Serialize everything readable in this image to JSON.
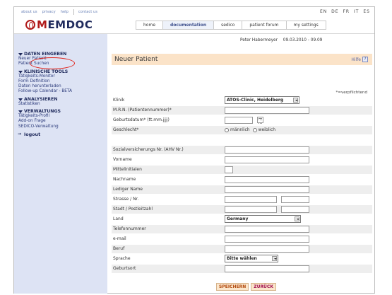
{
  "toplinks": [
    "about us",
    "privacy",
    "help",
    "contact us"
  ],
  "languages": [
    "EN",
    "DE",
    "FR",
    "IT",
    "ES"
  ],
  "logo": {
    "part1": "M",
    "part2": "EMDOC"
  },
  "nav": [
    "home",
    "documentation",
    "sedico",
    "patient forum",
    "my settings"
  ],
  "user": {
    "name": "Peter Habermeyer",
    "date": "09.03.2010 - 09.09"
  },
  "sidebar": {
    "sections": [
      {
        "title": "DATEN EINGEBEN",
        "items": [
          "Neuer Patient",
          "Patient Suchen"
        ]
      },
      {
        "title": "KLINISCHE TOOLS",
        "items": [
          "Tätigkeits-Monitor",
          "Form Definition",
          "Daten herunterladen",
          "Follow-up Calendar - BETA"
        ]
      },
      {
        "title": "ANALYSIEREN",
        "items": [
          "Statistiken"
        ]
      },
      {
        "title": "VERWALTUNGS",
        "items": [
          "Tätigkeits-Profil",
          "Add-on Frage",
          "SEDICO-Verwaltung"
        ]
      }
    ],
    "logout": "logout"
  },
  "page": {
    "title": "Neuer Patient",
    "help": "Hilfe",
    "help_icon": "?",
    "required_note": "*=verpflichtend"
  },
  "form": {
    "klinik": {
      "label": "Klinik",
      "value": "ATOS-Clinic, Heidelberg"
    },
    "mrn": {
      "label": "M.R.N. (Patientennummer)*",
      "value": ""
    },
    "geburtsdatum": {
      "label": "Geburtsdatum* (tt.mm.jjjj)",
      "value": ""
    },
    "geschlecht": {
      "label": "Geschlecht*",
      "options": [
        "männlich",
        "weiblich"
      ]
    },
    "svnr": {
      "label": "Sozialversicherungs Nr. (AHV Nr.)",
      "value": ""
    },
    "vorname": {
      "label": "Vorname",
      "value": ""
    },
    "mittelinitialen": {
      "label": "Mittelinitialen",
      "value": ""
    },
    "nachname": {
      "label": "Nachname",
      "value": ""
    },
    "ledigername": {
      "label": "Lediger Name",
      "value": ""
    },
    "strasse": {
      "label": "Strasse / Nr.",
      "value": ""
    },
    "stadt": {
      "label": "Stadt / Postleitzahl",
      "value": ""
    },
    "land": {
      "label": "Land",
      "value": "Germany"
    },
    "telefon": {
      "label": "Telefonnummer",
      "value": ""
    },
    "email": {
      "label": "e-mail",
      "value": ""
    },
    "beruf": {
      "label": "Beruf",
      "value": ""
    },
    "sprache": {
      "label": "Sprache",
      "value": "Bitte wählen"
    },
    "geburtsort": {
      "label": "Geburtsort",
      "value": ""
    }
  },
  "buttons": {
    "save": "SPEICHERN",
    "back": "ZURÜCK"
  }
}
